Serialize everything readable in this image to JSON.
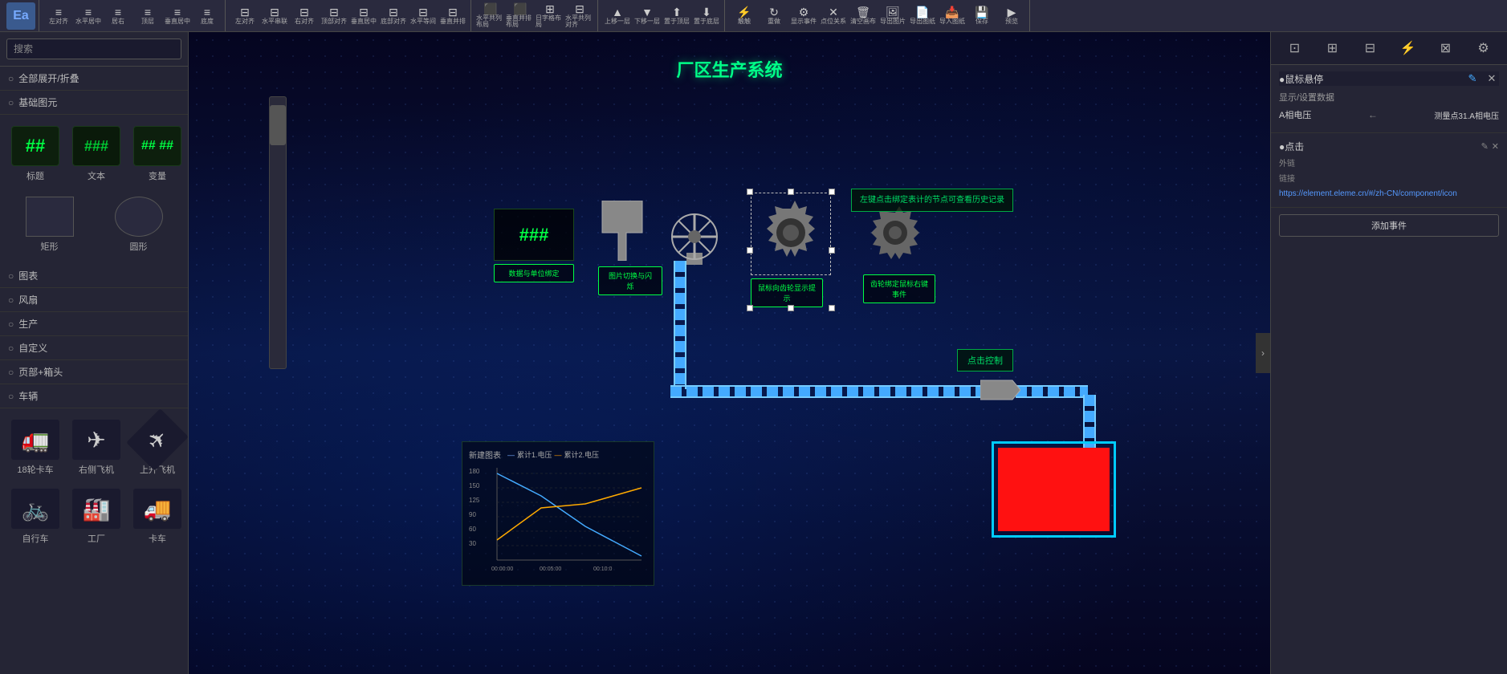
{
  "app": {
    "title": "Ea"
  },
  "toolbar": {
    "groups": [
      {
        "buttons": [
          {
            "id": "align-left-top",
            "icon": "⬛",
            "label": "水平居中"
          },
          {
            "id": "align-center",
            "icon": "⬛",
            "label": "居右"
          },
          {
            "id": "align-top",
            "icon": "⬛",
            "label": "顶层"
          },
          {
            "id": "align-vmid",
            "icon": "⬛",
            "label": "垂直居中"
          },
          {
            "id": "align-bottom",
            "icon": "⬛",
            "label": "底度"
          }
        ]
      }
    ],
    "buttons": [
      {
        "id": "btn1",
        "label": "左对齐"
      },
      {
        "id": "btn2",
        "label": "水平串联"
      },
      {
        "id": "btn3",
        "label": "右对齐"
      },
      {
        "id": "btn4",
        "label": "顶部对齐"
      },
      {
        "id": "btn5",
        "label": "垂直居中"
      },
      {
        "id": "btn6",
        "label": "底部对齐"
      },
      {
        "id": "btn7",
        "label": "水平等间"
      },
      {
        "id": "btn8",
        "label": "垂直并排"
      },
      {
        "id": "btn9",
        "label": "水平共列布局"
      },
      {
        "id": "btn10",
        "label": "垂直并排布局"
      },
      {
        "id": "btn11",
        "label": "日字格布局"
      },
      {
        "id": "btn12",
        "label": "上移一层"
      },
      {
        "id": "btn13",
        "label": "下移一层"
      },
      {
        "id": "btn14",
        "label": "置于顶层"
      },
      {
        "id": "btn15",
        "label": "置于底层"
      },
      {
        "id": "btn16",
        "label": "触触"
      },
      {
        "id": "btn17",
        "label": "重做"
      },
      {
        "id": "btn18",
        "label": "显示事件"
      },
      {
        "id": "btn19",
        "label": "点位关系"
      },
      {
        "id": "btn20",
        "label": "清空画布"
      },
      {
        "id": "btn21",
        "label": "导出图片"
      },
      {
        "id": "btn22",
        "label": "导出图纸"
      },
      {
        "id": "btn23",
        "label": "导入图纸"
      },
      {
        "id": "btn24",
        "label": "保存"
      },
      {
        "id": "btn25",
        "label": "预览"
      }
    ]
  },
  "left_panel": {
    "search_placeholder": "搜索",
    "sections": [
      {
        "id": "expand_all",
        "label": "全部展开/折叠",
        "icon": "○"
      },
      {
        "id": "basic_shapes",
        "label": "基础图元",
        "icon": "○"
      },
      {
        "id": "charts",
        "label": "图表",
        "icon": "○"
      },
      {
        "id": "fans",
        "label": "风扇",
        "icon": "○"
      },
      {
        "id": "production",
        "label": "生产",
        "icon": "○"
      },
      {
        "id": "custom",
        "label": "自定义",
        "icon": "○"
      },
      {
        "id": "headers",
        "label": "页部+箱头",
        "icon": "○"
      },
      {
        "id": "vehicles",
        "label": "车辆",
        "icon": "○"
      }
    ],
    "components": [
      {
        "id": "label",
        "label": "标题",
        "type": "green-hash"
      },
      {
        "id": "text",
        "label": "文本",
        "type": "green-hash-dark"
      },
      {
        "id": "variable",
        "label": "变量",
        "type": "green-hash-multi"
      },
      {
        "id": "rect",
        "label": "矩形",
        "type": "rect"
      },
      {
        "id": "circle",
        "label": "圆形",
        "type": "circle"
      }
    ],
    "vehicles": [
      {
        "id": "truck",
        "label": "18轮卡车",
        "icon": "🚛"
      },
      {
        "id": "plane-right",
        "label": "右侧飞机",
        "icon": "✈"
      },
      {
        "id": "plane-up",
        "label": "上升飞机",
        "icon": "✈"
      },
      {
        "id": "bike",
        "label": "自行车",
        "icon": "🚲"
      },
      {
        "id": "factory",
        "label": "工厂",
        "icon": "🏭"
      },
      {
        "id": "truck2",
        "label": "卡车",
        "icon": "🚚"
      }
    ]
  },
  "canvas": {
    "title": "厂区生产系统",
    "elements": {
      "hash_box": {
        "label": "###",
        "sublabel": "数据与单位绑定"
      },
      "image_element": {
        "label": "图片切换与闪烁"
      },
      "gear_selected": {
        "label": "鼠标向齿轮显示提示"
      },
      "gear_right": {
        "label": "齿轮绑定鼠标右键事件"
      },
      "click_control": {
        "label": "点击控制"
      },
      "info_box": {
        "label": "左键点击绑定表计的节点可查看历史记录"
      }
    }
  },
  "chart": {
    "title": "新建图表",
    "legend": [
      "累计1.电压",
      "累计2.电压"
    ],
    "y_axis": [
      "180",
      "150",
      "125",
      "90",
      "60",
      "30"
    ],
    "x_axis": [
      "00:00:00",
      "00:05:00",
      "00:10:0"
    ]
  },
  "right_panel": {
    "title": "●鼠标悬停",
    "section_display": {
      "label": "显示/设置数据",
      "field_label": "A相电压",
      "arrow": "←",
      "value": "测量点31.A相电压"
    },
    "section_click": {
      "title": "●点击",
      "outer_label": "外链",
      "link_label": "链接",
      "link_url": "https://element.eleme.cn/#/zh-CN/component/icon"
    },
    "add_event_label": "添加事件"
  }
}
